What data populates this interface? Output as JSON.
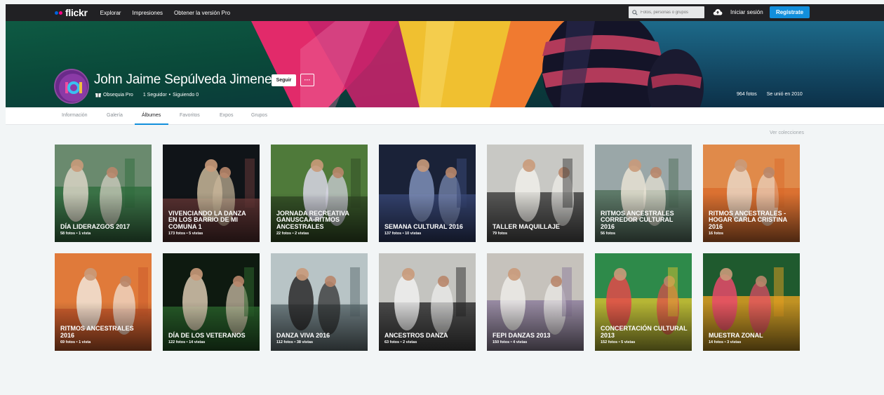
{
  "nav": {
    "logo_text": "flickr",
    "links": [
      "Explorar",
      "Impresiones",
      "Obtener la versión Pro"
    ],
    "search_placeholder": "Fotos, personas o grupos",
    "signin_label": "Iniciar sesión",
    "register_label": "Regístrate"
  },
  "profile": {
    "name": "John Jaime Sepúlveda Jimenez",
    "follow_label": "Seguir",
    "more_label": "···",
    "pro_label": "Obsequia Pro",
    "followers": "1 Seguidor",
    "following": "Siguiendo 0",
    "separator": "•",
    "photos_count": "964 fotos",
    "joined": "Se unió en 2010"
  },
  "tabs": [
    {
      "label": "Información",
      "active": false
    },
    {
      "label": "Galería",
      "active": false
    },
    {
      "label": "Álbumes",
      "active": true
    },
    {
      "label": "Favoritos",
      "active": false
    },
    {
      "label": "Expos",
      "active": false
    },
    {
      "label": "Grupos",
      "active": false
    }
  ],
  "collections_link": "Ver colecciones",
  "albums": [
    {
      "title": "DÍA LIDERAZGOS 2017",
      "meta": "58 fotos  •  1 vista",
      "palette": [
        "#6a8a6e",
        "#2e6b3c",
        "#d9d3c6"
      ]
    },
    {
      "title": "VIVENCIANDO LA DANZA EN LOS BARRIO DE MI COMUNA 1",
      "meta": "173 fotos  •  5 vistas",
      "palette": [
        "#101418",
        "#6b3a3a",
        "#c9b79a"
      ]
    },
    {
      "title": "JORNADA RECREATIVA GANUSCAA-RITMOS ANCESTRALES",
      "meta": "22 fotos  •  2 vistas",
      "palette": [
        "#4f7a3a",
        "#2f4a24",
        "#d8d6e6"
      ]
    },
    {
      "title": "SEMANA CULTURAL 2016",
      "meta": "137 fotos  •  10 vistas",
      "palette": [
        "#1a2238",
        "#3a4a7a",
        "#7f8fb8"
      ]
    },
    {
      "title": "TALLER MAQUILLAJE",
      "meta": "79 fotos",
      "palette": [
        "#c8c8c4",
        "#3a3a3a",
        "#f0eeea"
      ]
    },
    {
      "title": "RITMOS ANCESTRALES CORREDOR CULTURAL 2016",
      "meta": "56 fotos",
      "palette": [
        "#9aa7a8",
        "#4d6e58",
        "#e8e2d4"
      ]
    },
    {
      "title": "RITMOS ANCESTRALES - HOGAR CARLA CRISTINA 2016",
      "meta": "16 fotos",
      "palette": [
        "#e08a4a",
        "#d96a2a",
        "#e9d6c4"
      ]
    },
    {
      "title": "RITMOS ANCESTRALES 2016",
      "meta": "69 fotos  •  1 vista",
      "palette": [
        "#e07a3a",
        "#c9582a",
        "#f1e6da"
      ]
    },
    {
      "title": "DÍA DE LOS VETERANOS",
      "meta": "122 fotos  •  14 vistas",
      "palette": [
        "#0e1a10",
        "#2d6a2e",
        "#d9c9b0"
      ]
    },
    {
      "title": "DANZA VIVA 2016",
      "meta": "112 fotos  •  38 vistas",
      "palette": [
        "#b8c4c6",
        "#5a6a6e",
        "#2a2a2a"
      ]
    },
    {
      "title": "ANCESTROS DANZA",
      "meta": "63 fotos  •  2 vistas",
      "palette": [
        "#c4c4c0",
        "#2a2a2a",
        "#f0f0ee"
      ]
    },
    {
      "title": "FEPI DANZAS 2013",
      "meta": "150 fotos  •  4 vistas",
      "palette": [
        "#c6c2bc",
        "#8a7a9a",
        "#ecebe8"
      ]
    },
    {
      "title": "CONCERTACIÓN CULTURAL 2013",
      "meta": "152 fotos  •  5 vistas",
      "palette": [
        "#2e8a4a",
        "#d8c030",
        "#e24a4a"
      ]
    },
    {
      "title": "MUESTRA ZONAL",
      "meta": "14 fotos  •  3 vistas",
      "palette": [
        "#1f5a2e",
        "#e8a020",
        "#e84a6a"
      ]
    }
  ]
}
